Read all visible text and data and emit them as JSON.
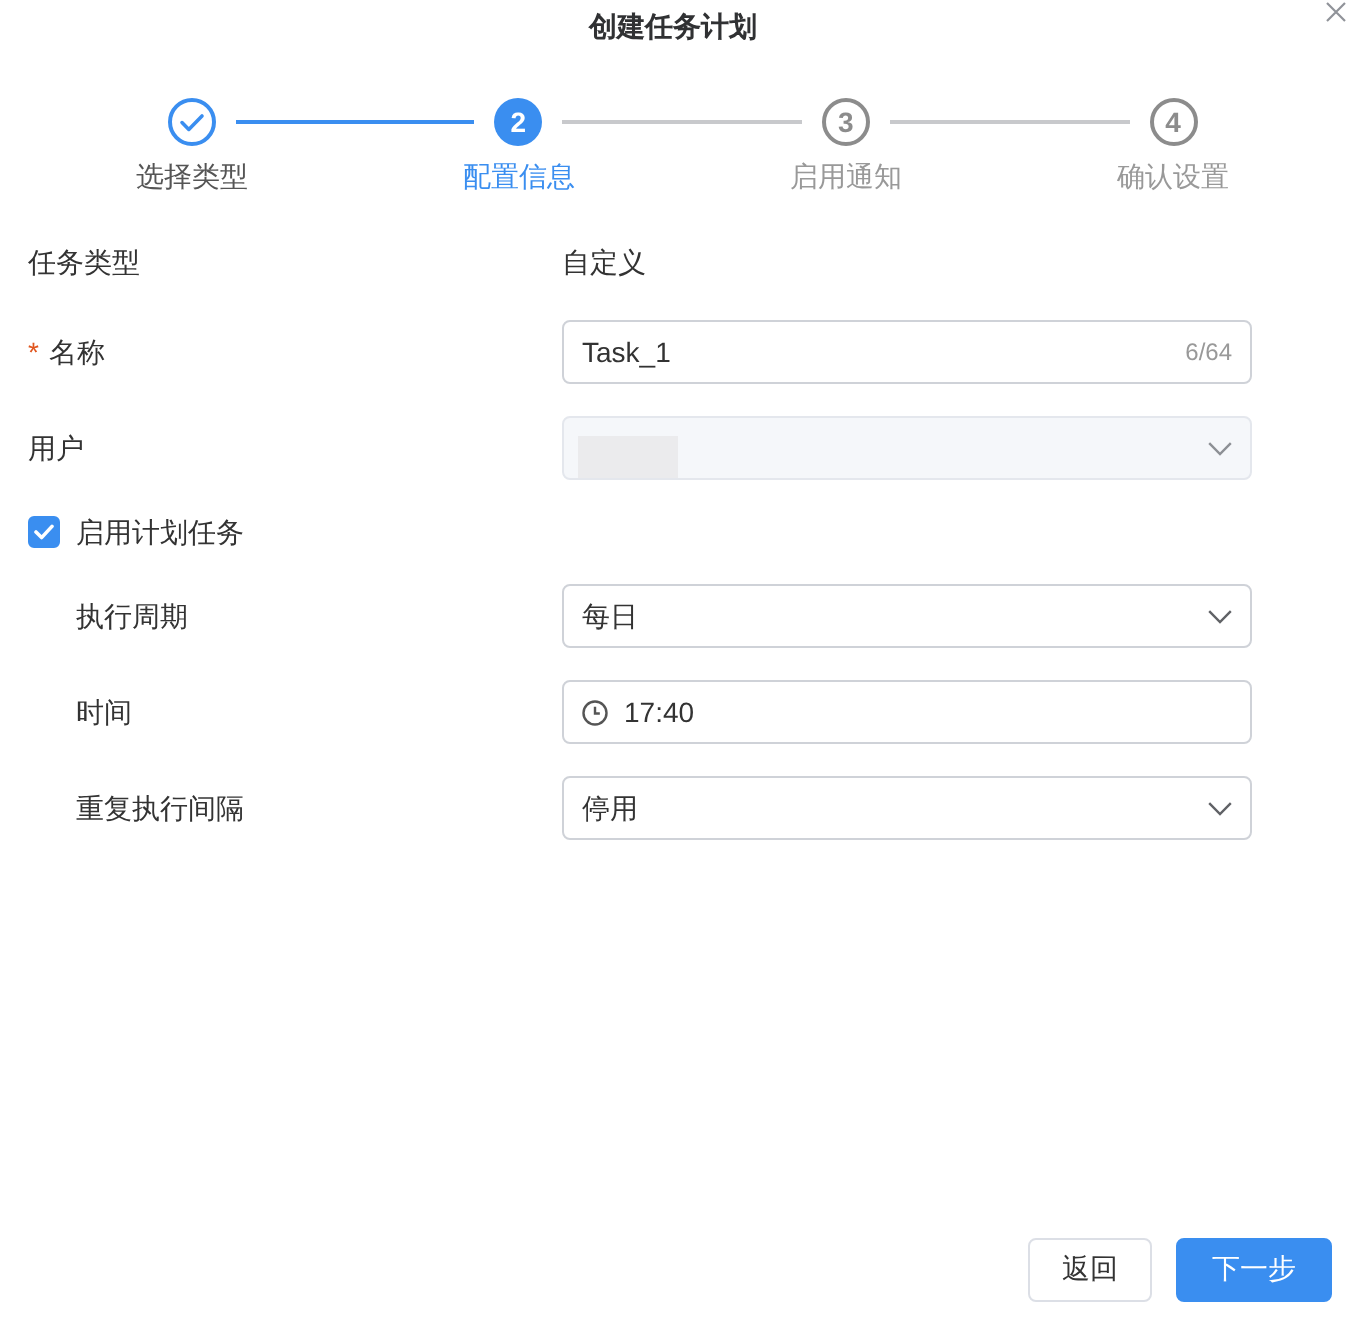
{
  "dialog": {
    "title": "创建任务计划"
  },
  "steps": [
    {
      "label": "选择类型",
      "completed": true,
      "selected": false
    },
    {
      "number": "2",
      "label": "配置信息",
      "completed": false,
      "selected": true
    },
    {
      "number": "3",
      "label": "启用通知",
      "completed": false,
      "selected": false
    },
    {
      "number": "4",
      "label": "确认设置",
      "completed": false,
      "selected": false
    }
  ],
  "fields": [
    {
      "kind": "static",
      "label": "任务类型",
      "value": "自定义"
    },
    {
      "kind": "text",
      "label": "名称",
      "required_mark": "*",
      "value": "Task_1",
      "counter": "6/64",
      "disabled": false
    },
    {
      "kind": "select",
      "label": "用户",
      "disabled": true,
      "value_hidden": true
    }
  ],
  "schedule": {
    "label": "启用计划任务",
    "checked": true,
    "fields": [
      {
        "kind": "select",
        "label": "执行周期",
        "value": "每日",
        "disabled": false
      },
      {
        "kind": "time",
        "label": "时间",
        "value": "17:40",
        "disabled": false
      },
      {
        "kind": "select",
        "label": "重复执行间隔",
        "value": "停用",
        "disabled": false
      }
    ]
  },
  "buttons": [
    {
      "label": "返回",
      "kind": "default"
    },
    {
      "label": "下一步",
      "kind": "primary"
    }
  ]
}
